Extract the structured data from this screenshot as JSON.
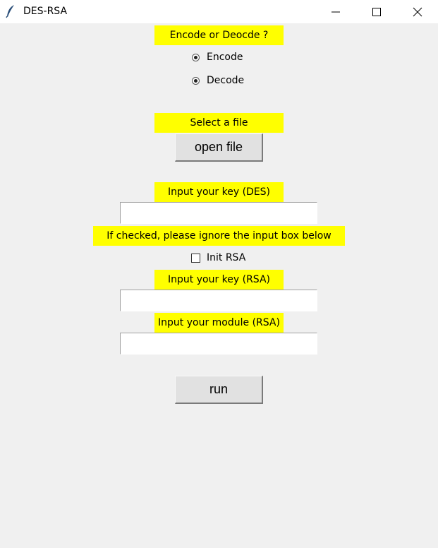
{
  "window": {
    "title": "DES-RSA",
    "icon": "feather-icon"
  },
  "mode": {
    "label": "Encode or Deocde ?",
    "options": [
      "Encode",
      "Decode"
    ]
  },
  "file": {
    "label": "Select a file",
    "button": "open file"
  },
  "des_key": {
    "label": "Input your key (DES)",
    "value": ""
  },
  "rsa_init": {
    "note": "If checked, please ignore the input box below",
    "checkbox_label": "Init RSA"
  },
  "rsa_key": {
    "label": "Input your key (RSA)",
    "value": ""
  },
  "rsa_module": {
    "label": "Input your module (RSA)",
    "value": ""
  },
  "run_button": "run",
  "colors": {
    "label_bg": "#ffff00",
    "window_bg": "#f0f0f0"
  }
}
